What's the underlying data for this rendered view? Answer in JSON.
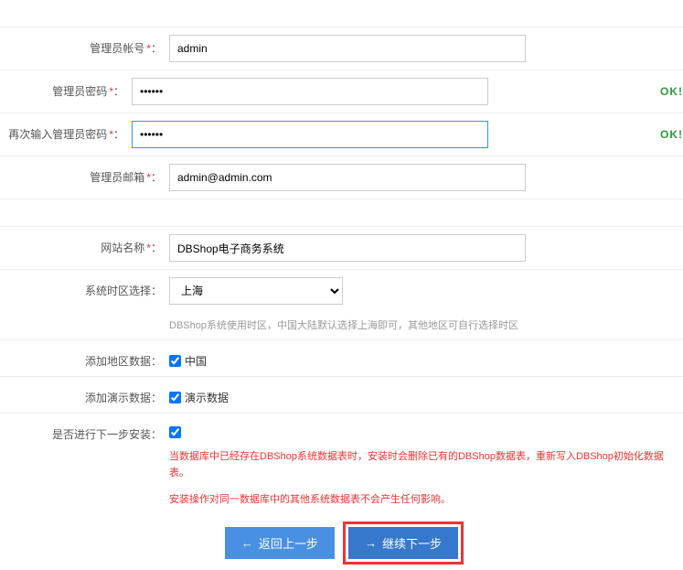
{
  "fields": {
    "admin_user": {
      "label": "管理员帐号",
      "value": "admin"
    },
    "admin_pass": {
      "label": "管理员密码",
      "value": "••••••",
      "status": "OK!"
    },
    "admin_pass2": {
      "label": "再次输入管理员密码",
      "value": "••••••",
      "status": "OK!"
    },
    "admin_email": {
      "label": "管理员邮箱",
      "value": "admin@admin.com"
    },
    "site_name": {
      "label": "网站名称",
      "value": "DBShop电子商务系统"
    },
    "timezone": {
      "label": "系统时区选择",
      "value": "上海",
      "help": "DBShop系统使用时区，中国大陆默认选择上海即可，其他地区可自行选择时区"
    },
    "region": {
      "label": "添加地区数据",
      "option": "中国"
    },
    "demo": {
      "label": "添加演示数据",
      "option": "演示数据"
    },
    "proceed": {
      "label": "是否进行下一步安装",
      "warn1": "当数据库中已经存在DBShop系统数据表时，安装时会删除已有的DBShop数据表，重新写入DBShop初始化数据表。",
      "warn2": "安装操作对同一数据库中的其他系统数据表不会产生任何影响。"
    }
  },
  "buttons": {
    "back": "返回上一步",
    "next": "继续下一步"
  },
  "colon": "：",
  "req": "*"
}
